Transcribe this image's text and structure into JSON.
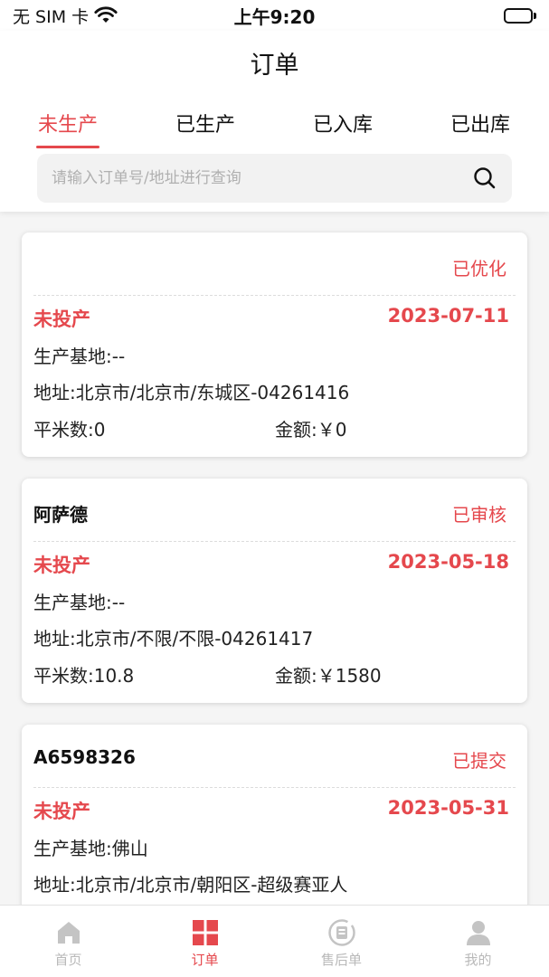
{
  "status_bar": {
    "carrier": "无 SIM 卡",
    "time": "上午9:20"
  },
  "header": {
    "title": "订单",
    "tabs": [
      {
        "label": "未生产",
        "active": true
      },
      {
        "label": "已生产",
        "active": false
      },
      {
        "label": "已入库",
        "active": false
      },
      {
        "label": "已出库",
        "active": false
      }
    ],
    "search": {
      "placeholder": "请输入订单号/地址进行查询",
      "value": ""
    }
  },
  "orders": [
    {
      "name": "",
      "status": "已优化",
      "production_status": "未投产",
      "date": "2023-07-11",
      "base": "生产基地:--",
      "address": "地址:北京市/北京市/东城区-04261416",
      "area": "平米数:0",
      "amount": "金额:￥0"
    },
    {
      "name": "阿萨德",
      "status": "已审核",
      "production_status": "未投产",
      "date": "2023-05-18",
      "base": "生产基地:--",
      "address": "地址:北京市/不限/不限-04261417",
      "area": "平米数:10.8",
      "amount": "金额:￥1580"
    },
    {
      "name": "A6598326",
      "status": "已提交",
      "production_status": "未投产",
      "date": "2023-05-31",
      "base": "生产基地:佛山",
      "address": "地址:北京市/北京市/朝阳区-超级赛亚人",
      "area": "",
      "amount": ""
    }
  ],
  "tab_bar": {
    "items": [
      {
        "label": "首页",
        "icon": "home-icon",
        "active": false
      },
      {
        "label": "订单",
        "icon": "order-grid-icon",
        "active": true
      },
      {
        "label": "售后单",
        "icon": "after-sale-icon",
        "active": false
      },
      {
        "label": "我的",
        "icon": "user-icon",
        "active": false
      }
    ]
  },
  "colors": {
    "accent": "#e5484d",
    "inactive_tab": "#b9b9b9",
    "background": "#f5f5f5"
  }
}
